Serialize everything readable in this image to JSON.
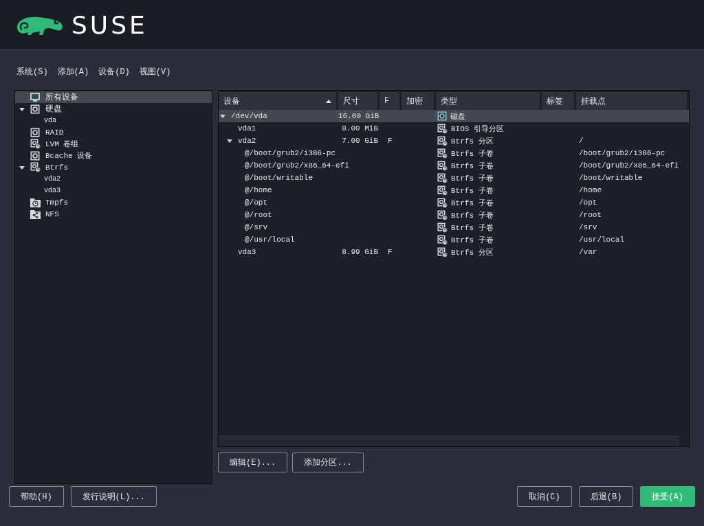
{
  "header": {
    "logo_text": "SUSE"
  },
  "menu": [
    {
      "label": "系统(S)"
    },
    {
      "label": "添加(A)"
    },
    {
      "label": "设备(D)"
    },
    {
      "label": "视图(V)"
    }
  ],
  "tree": [
    {
      "label": "所有设备",
      "kind": "all",
      "selected": true
    },
    {
      "label": "硬盘",
      "kind": "disk",
      "selected": false,
      "expanded": true,
      "children": [
        {
          "label": "vda",
          "selected": false
        }
      ]
    },
    {
      "label": "RAID",
      "kind": "raid",
      "selected": false
    },
    {
      "label": "LVM 卷组",
      "kind": "lvm",
      "selected": false
    },
    {
      "label": "Bcache 设备",
      "kind": "disk",
      "selected": false
    },
    {
      "label": "Btrfs",
      "kind": "lvm",
      "selected": false,
      "expanded": true,
      "children": [
        {
          "label": "vda2",
          "selected": false
        },
        {
          "label": "vda3",
          "selected": false
        }
      ]
    },
    {
      "label": "Tmpfs",
      "kind": "tmpfs",
      "selected": false
    },
    {
      "label": "NFS",
      "kind": "nfs",
      "selected": false
    }
  ],
  "table": {
    "columns": [
      {
        "label": "设备",
        "sorted": true
      },
      {
        "label": "尺寸",
        "sorted": false
      },
      {
        "label": "F",
        "sorted": false
      },
      {
        "label": "加密",
        "sorted": false
      },
      {
        "label": "类型",
        "sorted": false
      },
      {
        "label": "标签",
        "sorted": false
      },
      {
        "label": "挂载点",
        "sorted": false
      }
    ],
    "rows": [
      {
        "device": "/dev/vda",
        "size": "16.00 GiB",
        "type": "磁盘",
        "kind": "disk",
        "selected": true,
        "expanded": true,
        "children": [
          {
            "device": "vda1",
            "size": "8.00 MiB",
            "type": "BIOS 引导分区",
            "kind": "partition",
            "selected": false
          },
          {
            "device": "vda2",
            "size": "7.00 GiB",
            "f": "F",
            "type": "Btrfs 分区",
            "mount": "/",
            "kind": "partition",
            "selected": false,
            "expanded": true,
            "children": [
              {
                "device": "@/boot/grub2/i386-pc",
                "type": "Btrfs 子卷",
                "mount": "/boot/grub2/i386-pc",
                "kind": "partition",
                "selected": false
              },
              {
                "device": "@/boot/grub2/x86_64-efi",
                "type": "Btrfs 子卷",
                "mount": "/boot/grub2/x86_64-efi",
                "kind": "partition",
                "selected": false
              },
              {
                "device": "@/boot/writable",
                "type": "Btrfs 子卷",
                "mount": "/boot/writable",
                "kind": "partition",
                "selected": false
              },
              {
                "device": "@/home",
                "type": "Btrfs 子卷",
                "mount": "/home",
                "kind": "partition",
                "selected": false
              },
              {
                "device": "@/opt",
                "type": "Btrfs 子卷",
                "mount": "/opt",
                "kind": "partition",
                "selected": false
              },
              {
                "device": "@/root",
                "type": "Btrfs 子卷",
                "mount": "/root",
                "kind": "partition",
                "selected": false
              },
              {
                "device": "@/srv",
                "type": "Btrfs 子卷",
                "mount": "/srv",
                "kind": "partition",
                "selected": false
              },
              {
                "device": "@/usr/local",
                "type": "Btrfs 子卷",
                "mount": "/usr/local",
                "kind": "partition",
                "selected": false
              }
            ]
          },
          {
            "device": "vda3",
            "size": "8.99 GiB",
            "f": "F",
            "type": "Btrfs 分区",
            "mount": "/var",
            "kind": "partition",
            "selected": false
          }
        ]
      }
    ]
  },
  "table_buttons": [
    {
      "label": "编辑(E)..."
    },
    {
      "label": "添加分区..."
    }
  ],
  "footer_left": [
    {
      "label": "帮助(H)"
    },
    {
      "label": "发行说明(L)..."
    }
  ],
  "footer_right": [
    {
      "label": "取消(C)",
      "primary": false
    },
    {
      "label": "后退(B)",
      "primary": false
    },
    {
      "label": "接受(A)",
      "primary": true
    }
  ]
}
